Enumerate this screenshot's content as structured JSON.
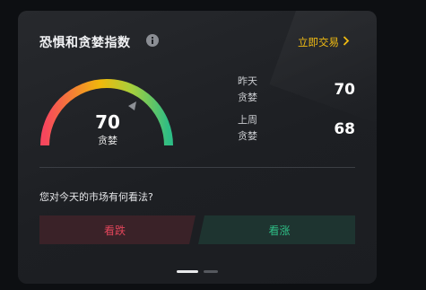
{
  "card": {
    "title": "恐惧和贪婪指数",
    "trade_link": "立即交易",
    "icons": {
      "info": "info-icon",
      "chevron": "chevron-right-icon",
      "pointer": "gauge-pointer-icon"
    }
  },
  "gauge": {
    "value": "70",
    "level": 70,
    "max": 100,
    "label": "贪婪",
    "colors": [
      "#f6465d",
      "#f0b90b",
      "#2ebd85"
    ]
  },
  "stats": [
    {
      "period": "昨天",
      "label": "贪婪",
      "value": "70"
    },
    {
      "period": "上周",
      "label": "贪婪",
      "value": "68"
    }
  ],
  "poll": {
    "question": "您对今天的市场有何看法?",
    "down_label": "看跌",
    "up_label": "看涨",
    "down_color": "#e0455a",
    "up_color": "#2ebd85"
  },
  "carousel": {
    "pages": 2,
    "active": 1
  }
}
